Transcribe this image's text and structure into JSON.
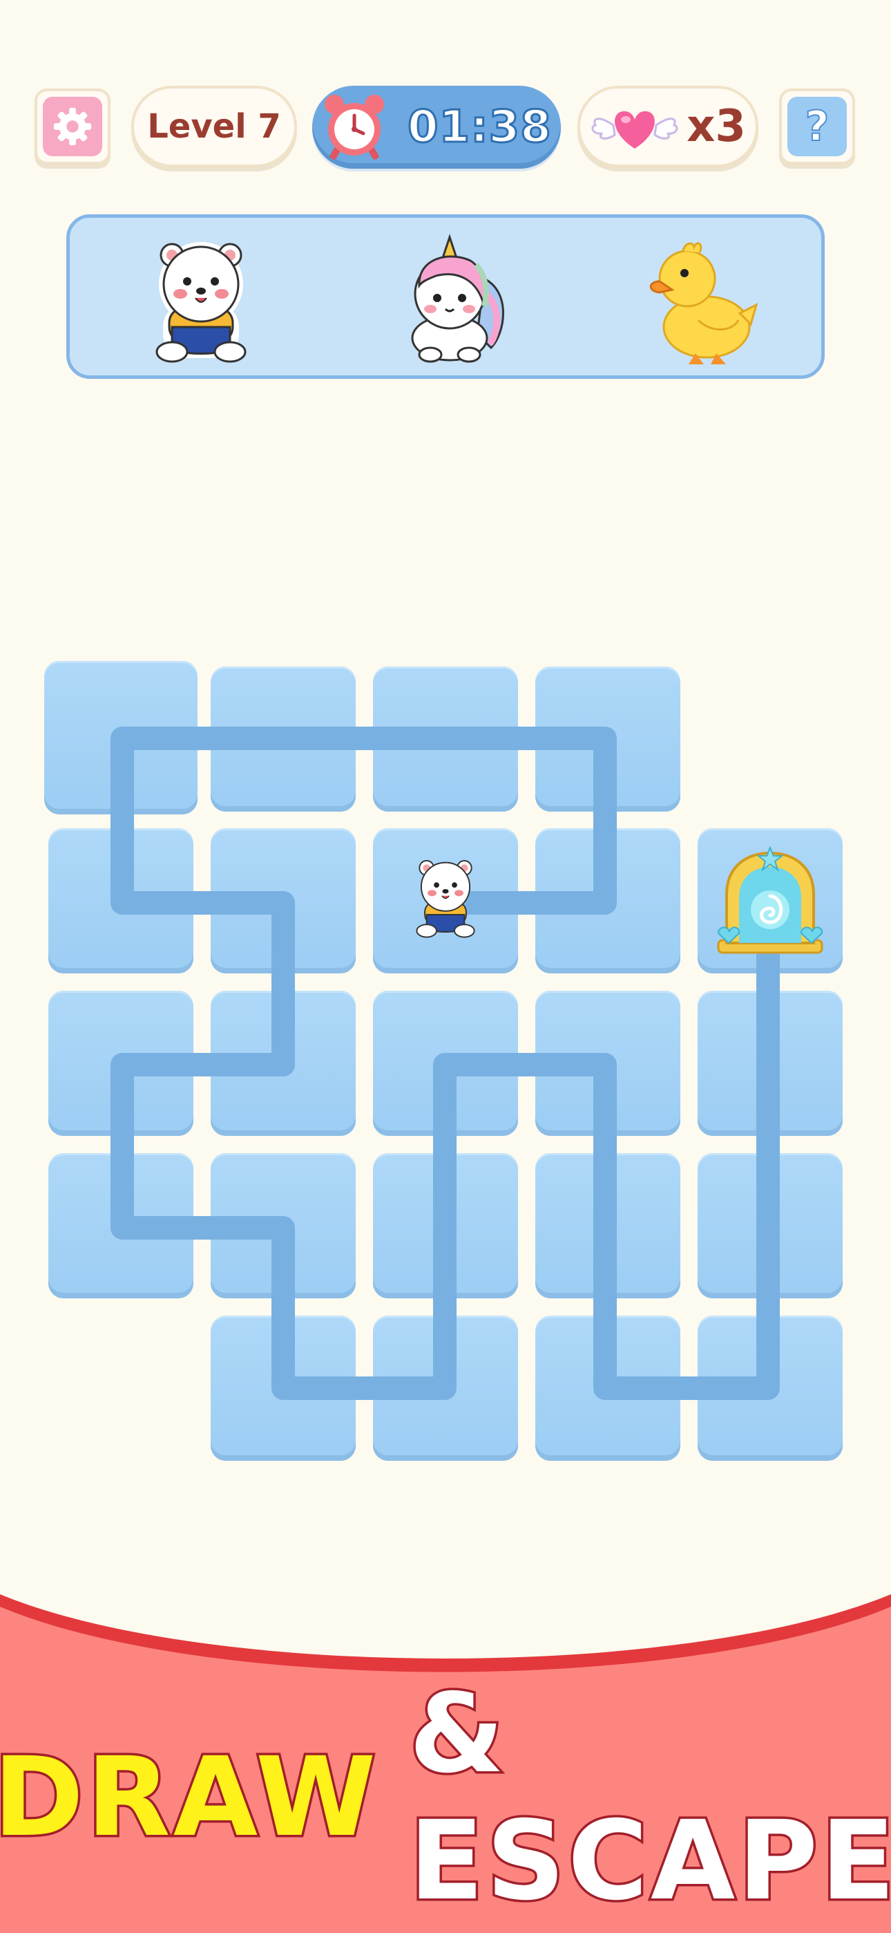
{
  "hud": {
    "level_label": "Level 7",
    "timer": "01:38",
    "lives": "x3",
    "settings_icon": "gear-icon",
    "help_icon": "question-mark-icon",
    "clock_icon": "alarm-clock-icon",
    "heart_icon": "winged-heart-icon"
  },
  "goals": [
    {
      "name": "bear",
      "icon": "bear-icon"
    },
    {
      "name": "unicorn",
      "icon": "unicorn-icon"
    },
    {
      "name": "duck",
      "icon": "duck-icon"
    }
  ],
  "board": {
    "player": {
      "icon": "bear-icon",
      "row": 1,
      "col": 2
    },
    "exit": {
      "icon": "portal-gate-icon",
      "row": 1,
      "col": 4
    },
    "missing_cells": [
      [
        0,
        4
      ],
      [
        4,
        0
      ]
    ]
  },
  "banner": {
    "title_part1": "DRAW",
    "title_part2": "& ESCAPE"
  },
  "colors": {
    "background": "#fdfaf0",
    "tile": "#a9d4f6",
    "path": "#7ab2e2",
    "banner": "#fd8580",
    "banner_edge": "#e3393c",
    "title_yellow": "#fff21a",
    "title_outline": "#a21f2a"
  }
}
